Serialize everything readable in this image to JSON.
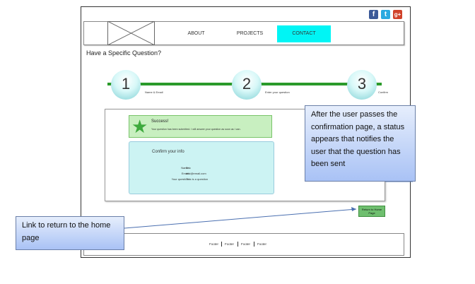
{
  "social": {
    "facebook": "f",
    "twitter": "t",
    "googleplus": "g+"
  },
  "nav": {
    "about": "ABOUT",
    "projects": "PROJECTS",
    "contact": "CONTACT"
  },
  "page_title": "Have a Specific Question?",
  "steps": [
    {
      "number": "1",
      "label": "Name & Email"
    },
    {
      "number": "2",
      "label": "Enter your question"
    },
    {
      "number": "3",
      "label": "Confirm"
    }
  ],
  "success": {
    "title": "Success!",
    "message": "Your question has been submitted. I will answer your question as soon as I can."
  },
  "confirm": {
    "title": "Confirm your info",
    "rows": [
      {
        "label": "Name:",
        "value": "Eric"
      },
      {
        "label": "Email:",
        "value": "test@email.com"
      },
      {
        "label": "Your question:",
        "value": "This is a question"
      }
    ]
  },
  "home_button": "Return to Home Page",
  "footer": [
    "Footer",
    "Footer",
    "Footer",
    "Footer"
  ],
  "callouts": {
    "status": "After the user passes the confirmation page, a status appears that notifies the user that the question has been sent",
    "link": "Link to return to the home page"
  },
  "colors": {
    "contact_tab": "#00f5f5",
    "progress_track": "#2a9a2a",
    "success_bg": "#c8efc0",
    "confirm_bg": "#ccf3f3",
    "callout": "#a9c2f5"
  }
}
